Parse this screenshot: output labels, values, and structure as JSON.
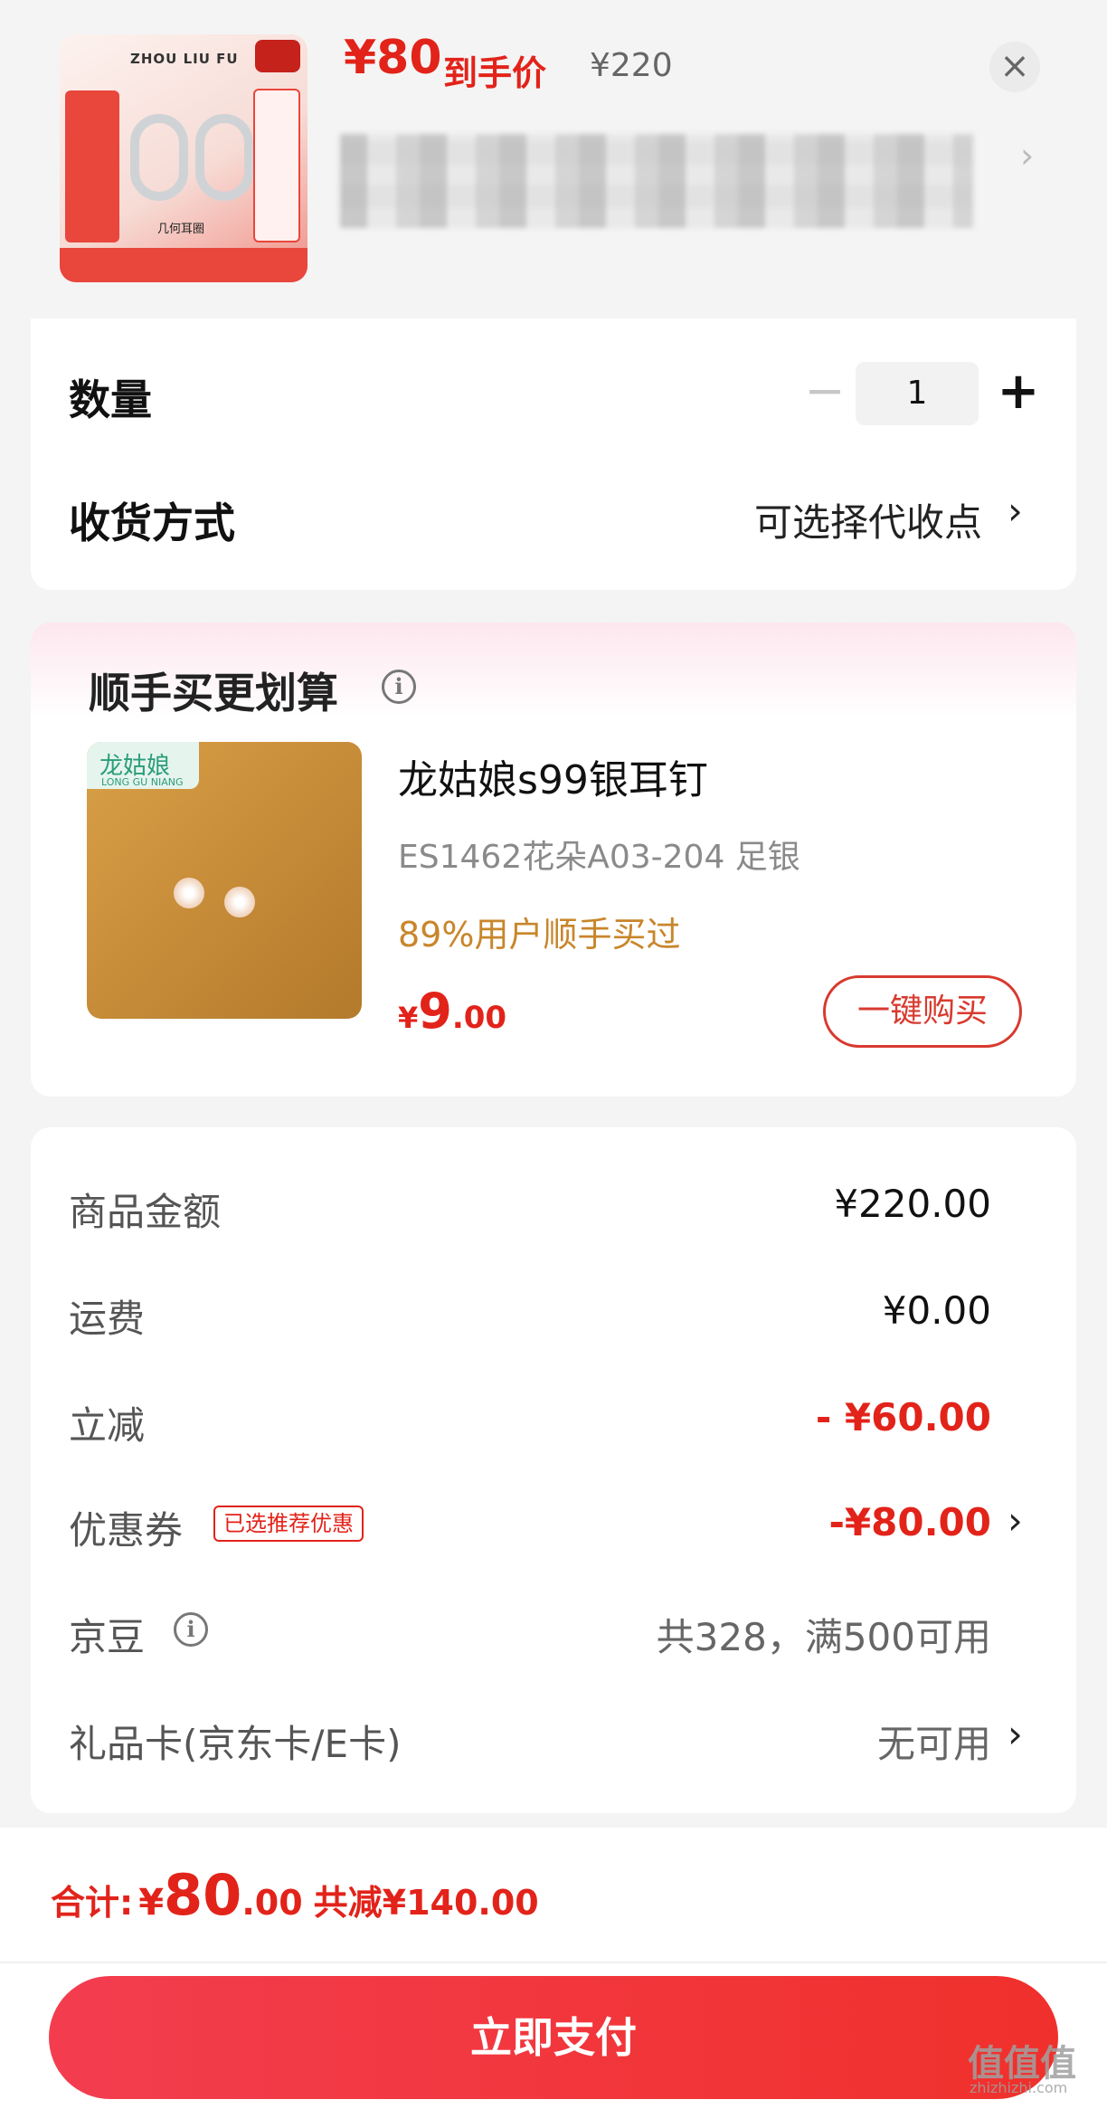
{
  "header": {
    "thumbnail": {
      "brand": "ZHOU LIU FU",
      "caption": "几何耳圈"
    },
    "price_current": "¥80",
    "price_current_label": "到手价",
    "price_original": "¥220",
    "close_icon": "close-icon",
    "title_chevron": "›"
  },
  "quantity": {
    "label": "数量",
    "minus": "−",
    "value": "1",
    "plus": "+"
  },
  "shipping": {
    "label": "收货方式",
    "value": "可选择代收点",
    "chevron": "›"
  },
  "addon": {
    "title": "顺手买更划算",
    "info_icon": "i",
    "image_logo": "龙姑娘",
    "image_logo_sub": "LONG GU NIANG",
    "name": "龙姑娘s99银耳钉",
    "spec": "ES1462花朵A03-204   足银",
    "social_proof": "89%用户顺手买过",
    "price_symbol": "¥",
    "price_int": "9",
    "price_dec": ".00",
    "buy_label": "一键购买"
  },
  "summary": {
    "rows": [
      {
        "label": "商品金额",
        "value": "¥220.00",
        "color": "#111111"
      },
      {
        "label": "运费",
        "value": "¥0.00",
        "color": "#111111"
      },
      {
        "label": "立减",
        "value": "- ¥60.00",
        "color": "#e2231a"
      },
      {
        "label": "优惠券",
        "tag": "已选推荐优惠",
        "value": "-¥80.00",
        "color": "#e2231a",
        "chevron": "›"
      },
      {
        "label": "京豆",
        "info_icon": "i",
        "value": "共328，满500可用",
        "color": "#666666"
      },
      {
        "label": "礼品卡(京东卡/E卡)",
        "value": "无可用",
        "color": "#666666",
        "chevron": "›"
      }
    ]
  },
  "footer": {
    "total_label": "合计:",
    "total_symbol": "¥",
    "total_int": "80",
    "total_dec": ".00",
    "total_saving": "共减¥140.00",
    "pay_button": "立即支付",
    "watermark": "值值值",
    "watermark_sub": "zhizhizhi.com"
  },
  "colors": {
    "accent_red": "#e2231a",
    "social_gold": "#c8862b",
    "background": "#f4f4f4"
  }
}
